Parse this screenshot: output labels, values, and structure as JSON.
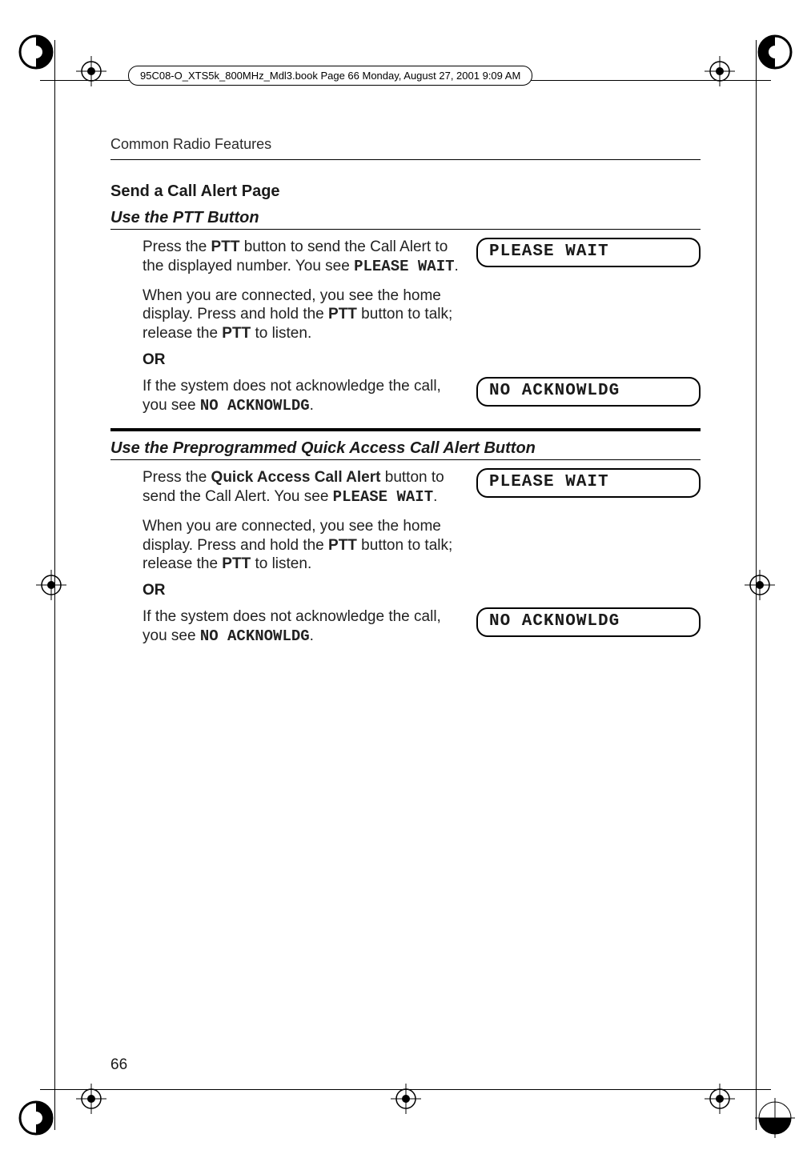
{
  "file_tag": "95C08-O_XTS5k_800MHz_Mdl3.book  Page 66  Monday, August 27, 2001  9:09 AM",
  "running_head": "Common Radio Features",
  "section_title": "Send a Call Alert Page",
  "ptt": {
    "subhead": "Use the PTT Button",
    "step1_a": "Press the ",
    "step1_b": "PTT",
    "step1_c": " button to send the Call Alert to the displayed number. You see ",
    "step1_lcd": "PLEASE WAIT",
    "step1_d": ".",
    "display1": "PLEASE WAIT",
    "step2_a": "When you are connected, you see the home display. Press and hold the ",
    "step2_b": "PTT",
    "step2_c": " button to talk; release the ",
    "step2_d": "PTT",
    "step2_e": " to listen.",
    "or": "OR",
    "step3_a": "If the system does not acknowledge the call, you see ",
    "step3_lcd": "NO ACKNOWLDG",
    "step3_b": ".",
    "display2": "NO ACKNOWLDG"
  },
  "qa": {
    "subhead": "Use the Preprogrammed Quick Access Call Alert Button",
    "step1_a": "Press the ",
    "step1_b": "Quick Access Call Alert",
    "step1_c": " button to send the Call Alert. You see ",
    "step1_lcd": "PLEASE WAIT",
    "step1_d": ".",
    "display1": "PLEASE WAIT",
    "step2_a": "When you are connected, you see the home display. Press and hold the ",
    "step2_b": "PTT",
    "step2_c": " button to talk; release the ",
    "step2_d": "PTT",
    "step2_e": " to listen.",
    "or": "OR",
    "step3_a": "If the system does not acknowledge the call, you see ",
    "step3_lcd": "NO ACKNOWLDG",
    "step3_b": ".",
    "display2": "NO ACKNOWLDG"
  },
  "page_number": "66"
}
